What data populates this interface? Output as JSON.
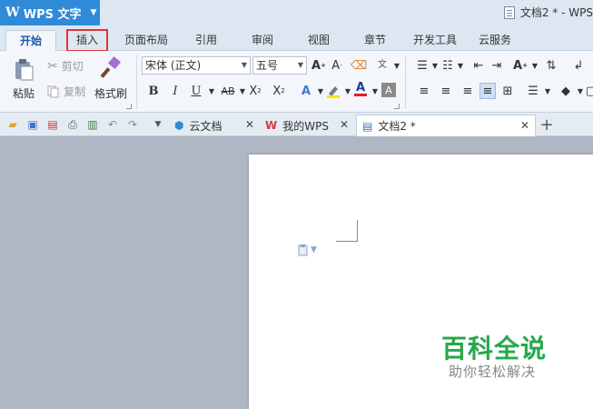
{
  "app": {
    "logo": "W",
    "name": "WPS 文字",
    "menu_caret": "▼"
  },
  "window": {
    "title": "文档2 * - WPS"
  },
  "tabs": [
    {
      "label": "开始",
      "active": true
    },
    {
      "label": "插入",
      "highlight": true
    },
    {
      "label": "页面布局"
    },
    {
      "label": "引用"
    },
    {
      "label": "审阅"
    },
    {
      "label": "视图"
    },
    {
      "label": "章节"
    },
    {
      "label": "开发工具"
    },
    {
      "label": "云服务"
    }
  ],
  "ribbon": {
    "paste_label": "粘贴",
    "cut_label": "剪切",
    "copy_label": "复制",
    "format_painter_label": "格式刷",
    "font_name": "宋体 (正文)",
    "font_size": "五号"
  },
  "doc_tabs": [
    {
      "label": "云文档"
    },
    {
      "label": "我的WPS"
    },
    {
      "label": "文档2 *",
      "active": true
    }
  ],
  "watermark": {
    "title": "百科全说",
    "subtitle": "助你轻松解决"
  },
  "colors": {
    "accent": "#2f8ad8",
    "highlight_box": "#e0343a",
    "watermark_green": "#25a84b"
  }
}
